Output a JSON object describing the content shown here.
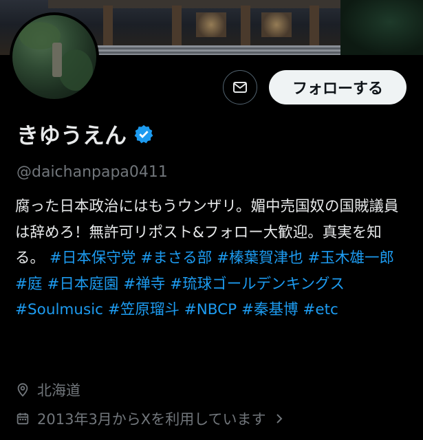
{
  "profile": {
    "display_name": "きゆうえん",
    "handle": "@daichanpapa0411",
    "bio_intro": "腐った日本政治にはもうウンザリ。媚中売国奴の国賊議員は辞めろ！無許可リポスト&フォロー大歓迎。真実を知る。",
    "hashtags": [
      "#日本保守党",
      "#まさる部",
      "#榛葉賀津也",
      "#玉木雄一郎",
      "#庭",
      "#日本庭園",
      "#禅寺",
      "#琉球ゴールデンキングス",
      "#Soulmusic",
      "#笠原瑠斗",
      "#NBCP",
      "#秦基博",
      "#etc"
    ],
    "location": "北海道",
    "joined": "2013年3月からXを利用しています"
  },
  "actions": {
    "follow_label": "フォローする"
  },
  "icons": {
    "message": "mail-icon",
    "verified": "verified-badge-icon",
    "location": "location-pin-icon",
    "joined": "calendar-icon",
    "chevron": "chevron-right-icon"
  },
  "colors": {
    "background": "#000000",
    "text": "#e7e9ea",
    "muted": "#71767b",
    "link": "#1d9bf0",
    "verified": "#1d9bf0",
    "follow_bg": "#eff3f4"
  }
}
